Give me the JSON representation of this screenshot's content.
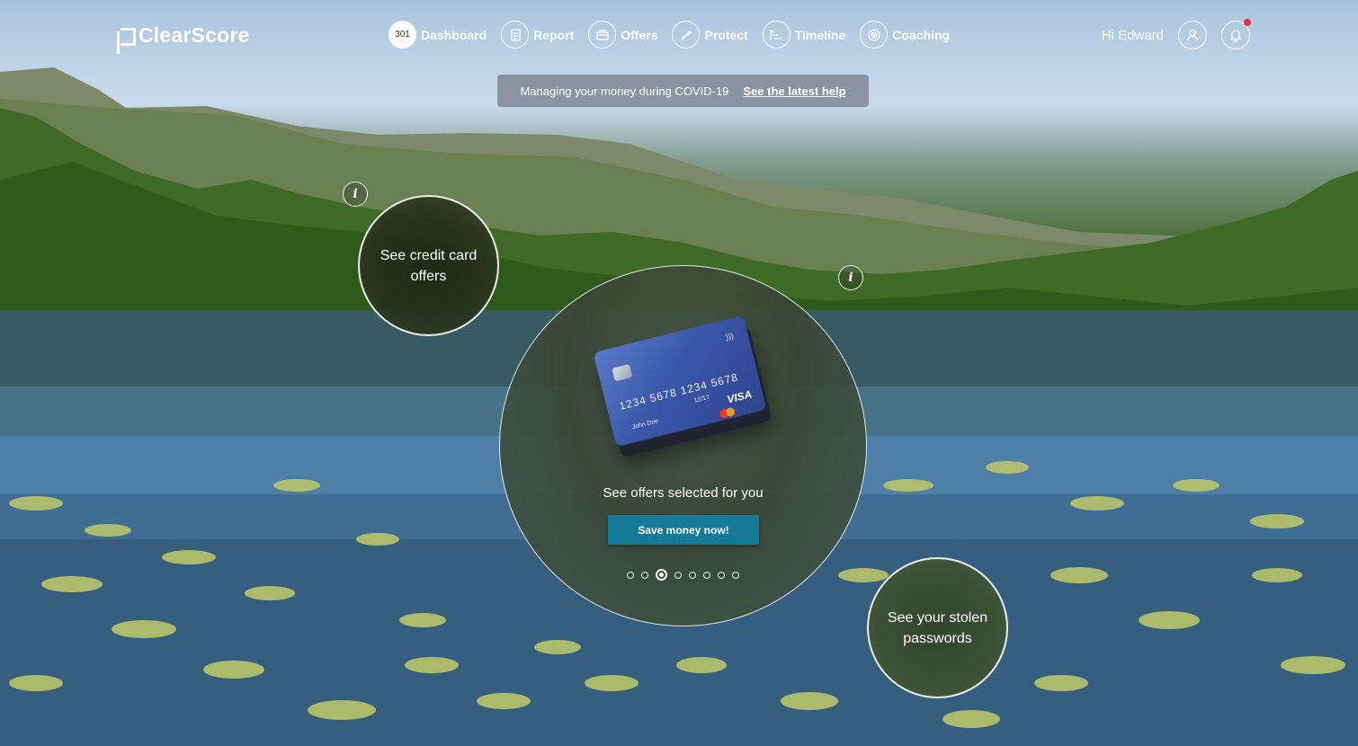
{
  "brand": {
    "name": "ClearScore"
  },
  "nav": {
    "score": "301",
    "items": [
      {
        "label": "Dashboard",
        "icon": "score-badge"
      },
      {
        "label": "Report",
        "icon": "report-icon"
      },
      {
        "label": "Offers",
        "icon": "offers-icon"
      },
      {
        "label": "Protect",
        "icon": "protect-icon"
      },
      {
        "label": "Timeline",
        "icon": "timeline-icon"
      },
      {
        "label": "Coaching",
        "icon": "coaching-icon"
      }
    ]
  },
  "user": {
    "greeting": "Hi Edward",
    "has_notification": true
  },
  "banner": {
    "text": "Managing your money during COVID-19",
    "link": "See the latest help"
  },
  "bubbles": {
    "credit_card": "See credit card offers",
    "passwords": "See your stolen passwords"
  },
  "main_card": {
    "card": {
      "number": "1234  5678  1234  5678",
      "expiry": "12/17",
      "name": "John Doe",
      "brand": "VISA"
    },
    "text": "See offers selected for you",
    "cta": "Save money now!",
    "carousel": {
      "count": 8,
      "active_index": 2
    }
  },
  "colors": {
    "cta": "#157a98",
    "notification": "#e0333c"
  }
}
